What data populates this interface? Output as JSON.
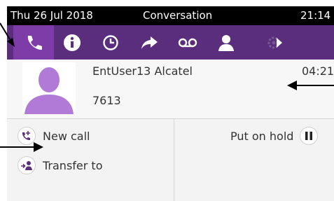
{
  "status_bar": {
    "date": "Thu 26 Jul 2018",
    "title": "Conversation",
    "time": "21:14"
  },
  "toolbar": {
    "buttons": [
      {
        "icon": "phone-handset-icon",
        "active": true
      },
      {
        "icon": "info-icon",
        "active": false
      },
      {
        "icon": "history-clock-icon",
        "active": false
      },
      {
        "icon": "forward-arrow-icon",
        "active": false
      },
      {
        "icon": "voicemail-icon",
        "active": false
      },
      {
        "icon": "contact-person-icon",
        "active": false
      },
      {
        "icon": "settings-more-icon",
        "active": false
      }
    ]
  },
  "contact": {
    "name": "EntUser13 Alcatel",
    "number": "7613",
    "duration": "04:21",
    "avatar_color": "#b07ad6"
  },
  "actions": {
    "new_call": "New call",
    "transfer": "Transfer to",
    "hold": "Put on hold"
  },
  "colors": {
    "toolbar": "#5a2d7d",
    "active_tab": "#7d3ca8",
    "status_bar": "#000000"
  }
}
